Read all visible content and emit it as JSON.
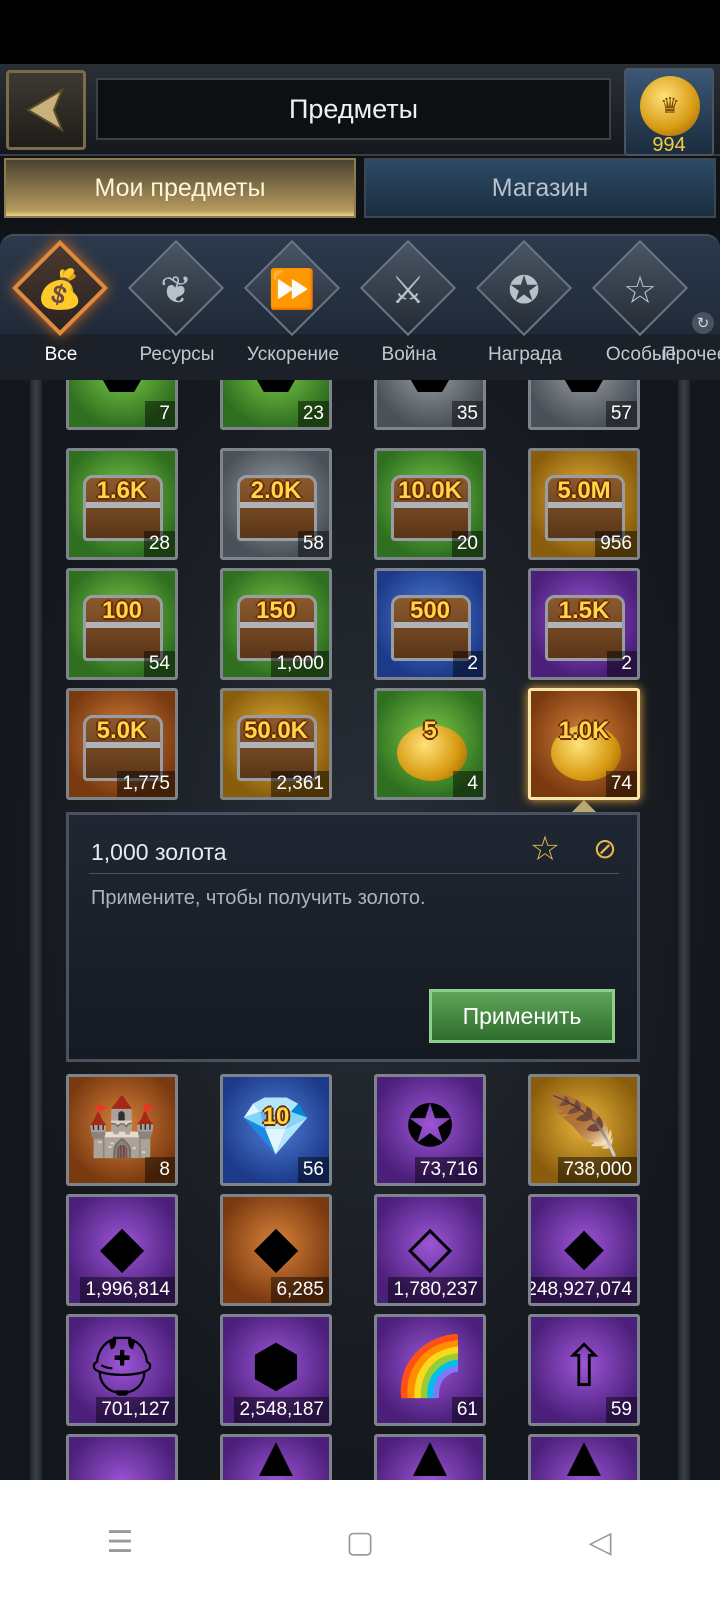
{
  "header": {
    "title": "Предметы",
    "gold_amount": "994"
  },
  "tabs": {
    "my_items": "Мои предметы",
    "shop": "Магазин"
  },
  "categories": [
    "Все",
    "Ресурсы",
    "Ускорение",
    "Война",
    "Награда",
    "Особые",
    "Прочее"
  ],
  "items": [
    {
      "label": "",
      "count": "7"
    },
    {
      "label": "",
      "count": "23"
    },
    {
      "label": "",
      "count": "35"
    },
    {
      "label": "",
      "count": "57"
    },
    {
      "label": "1.6K",
      "count": "28"
    },
    {
      "label": "2.0K",
      "count": "58"
    },
    {
      "label": "10.0K",
      "count": "20"
    },
    {
      "label": "5.0M",
      "count": "956"
    },
    {
      "label": "100",
      "count": "54"
    },
    {
      "label": "150",
      "count": "1,000"
    },
    {
      "label": "500",
      "count": "2"
    },
    {
      "label": "1.5K",
      "count": "2"
    },
    {
      "label": "5.0K",
      "count": "1,775"
    },
    {
      "label": "50.0K",
      "count": "2,361"
    },
    {
      "label": "5",
      "count": "4"
    },
    {
      "label": "1.0K",
      "count": "74"
    },
    {
      "label": "",
      "count": "8"
    },
    {
      "label": "10",
      "count": "56"
    },
    {
      "label": "",
      "count": "73,716"
    },
    {
      "label": "",
      "count": "738,000"
    },
    {
      "label": "",
      "count": "1,996,814"
    },
    {
      "label": "",
      "count": "6,285"
    },
    {
      "label": "",
      "count": "1,780,237"
    },
    {
      "label": "",
      "count": "248,927,074"
    },
    {
      "label": "",
      "count": "701,127"
    },
    {
      "label": "",
      "count": "2,548,187"
    },
    {
      "label": "",
      "count": "61"
    },
    {
      "label": "",
      "count": "59"
    }
  ],
  "detail": {
    "title": "1,000 золота",
    "description": "Примените, чтобы получить золото.",
    "apply_label": "Применить"
  },
  "nav": {
    "menu_icon": "☰",
    "home_icon": "▢",
    "back_icon": "◁"
  }
}
